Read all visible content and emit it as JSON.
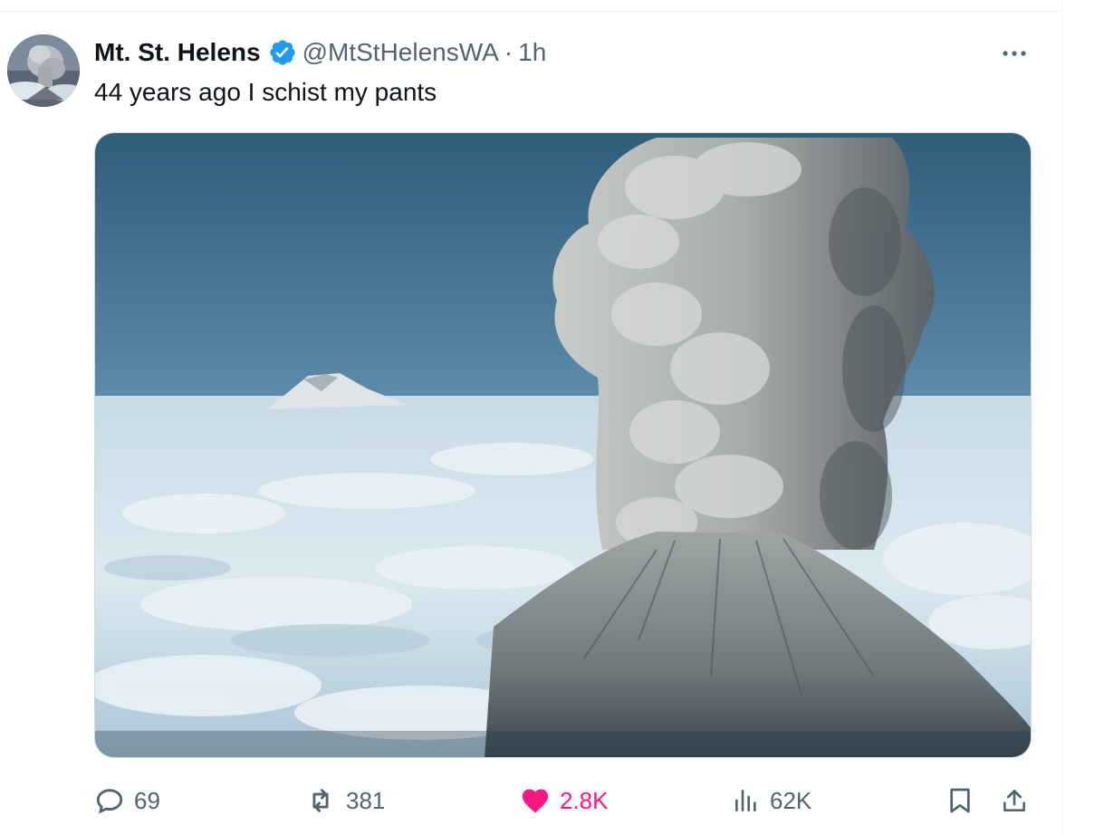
{
  "tweet": {
    "author": {
      "display_name": "Mt. St. Helens",
      "handle": "@MtStHelensWA",
      "verified": true,
      "time": "1h"
    },
    "separator": "·",
    "text": "44 years ago I schist my pants",
    "media": {
      "subject": "volcano eruption plume above clouds"
    },
    "actions": {
      "replies": "69",
      "reposts": "381",
      "likes": "2.8K",
      "liked": true,
      "views": "62K"
    }
  },
  "icons": {
    "more": "more-horizontal-icon",
    "reply": "reply-icon",
    "repost": "repost-icon",
    "like": "heart-icon",
    "views": "views-chart-icon",
    "bookmark": "bookmark-icon",
    "share": "share-icon",
    "verified": "verified-badge-icon"
  },
  "colors": {
    "verified": "#1d9bf0",
    "like": "#f91880",
    "secondary_text": "#536471",
    "primary_text": "#0f1419"
  }
}
